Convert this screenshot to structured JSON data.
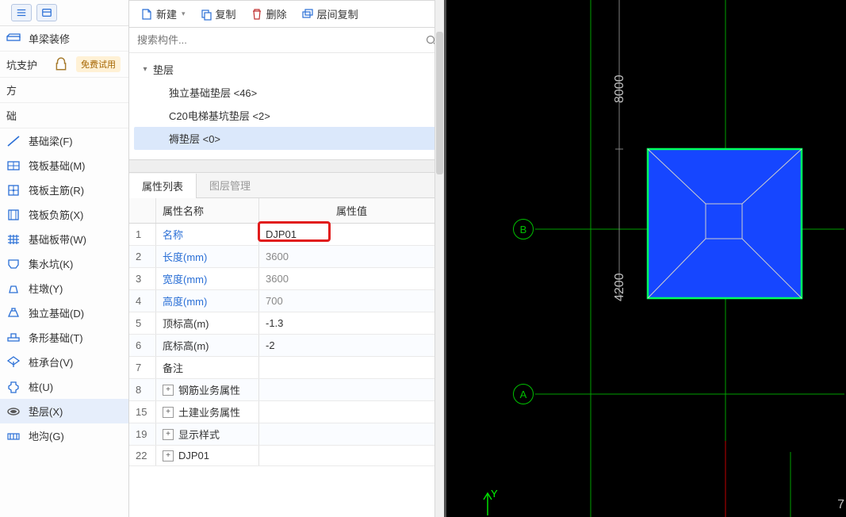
{
  "sidebar": {
    "special": {
      "label": "单梁装修"
    },
    "pit": {
      "label": "坑支护",
      "badge": "免费试用"
    },
    "group1": "方",
    "group2": "础",
    "items": [
      {
        "label": "基础梁(F)"
      },
      {
        "label": "筏板基础(M)"
      },
      {
        "label": "筏板主筋(R)"
      },
      {
        "label": "筏板负筋(X)"
      },
      {
        "label": "基础板带(W)"
      },
      {
        "label": "集水坑(K)"
      },
      {
        "label": "柱墩(Y)"
      },
      {
        "label": "独立基础(D)"
      },
      {
        "label": "条形基础(T)"
      },
      {
        "label": "桩承台(V)"
      },
      {
        "label": "桩(U)"
      },
      {
        "label": "垫层(X)"
      },
      {
        "label": "地沟(G)"
      }
    ]
  },
  "toolbar": {
    "new": "新建",
    "copy": "复制",
    "delete": "删除",
    "floorcopy": "层间复制"
  },
  "search": {
    "placeholder": "搜索构件..."
  },
  "tree": {
    "parent": "垫层",
    "children": [
      {
        "label": "独立基础垫层 <46>"
      },
      {
        "label": "C20电梯基坑垫层 <2>"
      },
      {
        "label": "褥垫层 <0>"
      }
    ]
  },
  "prop": {
    "tabs": {
      "list": "属性列表",
      "layer": "图层管理"
    },
    "headers": {
      "name": "属性名称",
      "value": "属性值"
    },
    "rows": [
      {
        "idx": "1",
        "name": "名称",
        "val": "DJP01",
        "link": true
      },
      {
        "idx": "2",
        "name": "长度(mm)",
        "val": "3600",
        "link": true,
        "gray": true
      },
      {
        "idx": "3",
        "name": "宽度(mm)",
        "val": "3600",
        "link": true,
        "gray": true
      },
      {
        "idx": "4",
        "name": "高度(mm)",
        "val": "700",
        "link": true,
        "gray": true
      },
      {
        "idx": "5",
        "name": "顶标高(m)",
        "val": "-1.3"
      },
      {
        "idx": "6",
        "name": "底标高(m)",
        "val": "-2"
      },
      {
        "idx": "7",
        "name": "备注",
        "val": ""
      },
      {
        "idx": "8",
        "name": "钢筋业务属性",
        "val": "",
        "exp": true
      },
      {
        "idx": "15",
        "name": "土建业务属性",
        "val": "",
        "exp": true
      },
      {
        "idx": "19",
        "name": "显示样式",
        "val": "",
        "exp": true
      },
      {
        "idx": "22",
        "name": "DJP01",
        "val": "",
        "exp": true
      }
    ]
  },
  "viewport": {
    "axisB": "B",
    "axisA": "A",
    "dim1": "8000",
    "dim2": "4200",
    "yaxis": "Y",
    "trailnum": "7"
  },
  "chart_data": {
    "type": "table",
    "title": "褥垫层 DJP01 属性",
    "rows": [
      {
        "属性名称": "名称",
        "属性值": "DJP01"
      },
      {
        "属性名称": "长度(mm)",
        "属性值": 3600
      },
      {
        "属性名称": "宽度(mm)",
        "属性值": 3600
      },
      {
        "属性名称": "高度(mm)",
        "属性值": 700
      },
      {
        "属性名称": "顶标高(m)",
        "属性值": -1.3
      },
      {
        "属性名称": "底标高(m)",
        "属性值": -2
      },
      {
        "属性名称": "备注",
        "属性值": ""
      }
    ]
  }
}
